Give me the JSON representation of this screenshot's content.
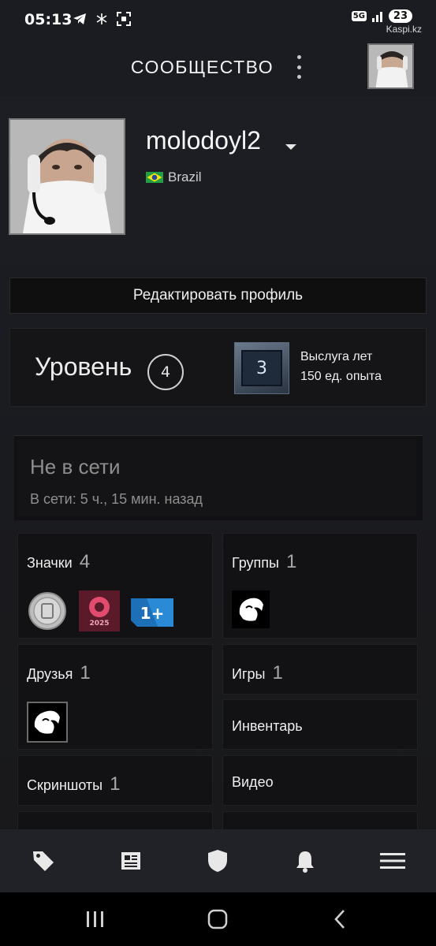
{
  "status_bar": {
    "time": "05:13",
    "network": "5G",
    "battery": "23",
    "watermark": "Kaspi.kz"
  },
  "header": {
    "title": "СООБЩЕСТВО",
    "menu_icon": "kebab-menu-icon",
    "avatar_icon": "user-avatar"
  },
  "profile": {
    "username": "molodoyl2",
    "country": "Brazil",
    "country_flag": "brazil-flag-icon",
    "edit_button": "Редактировать профиль"
  },
  "level": {
    "label": "Уровень",
    "value": "4",
    "badge_value": "3",
    "badge_title": "Выслуга лет",
    "badge_xp": "150 ед. опыта"
  },
  "status": {
    "title": "Не в сети",
    "last_online": "В сети: 5 ч., 15 мин. назад"
  },
  "tiles": {
    "badges": {
      "label": "Значки",
      "count": "4"
    },
    "groups": {
      "label": "Группы",
      "count": "1"
    },
    "friends": {
      "label": "Друзья",
      "count": "1"
    },
    "games": {
      "label": "Игры",
      "count": "1"
    },
    "inventory": {
      "label": "Инвентарь"
    },
    "screenshots": {
      "label": "Скриншоты",
      "count": "1"
    },
    "videos": {
      "label": "Видео"
    }
  },
  "badge_icons": [
    {
      "name": "coin-badge-icon"
    },
    {
      "name": "steam-2025-badge-icon",
      "label": "2025"
    },
    {
      "name": "years-of-service-badge-icon",
      "label": "1+"
    }
  ],
  "bottom_nav": [
    {
      "name": "store-tag-icon"
    },
    {
      "name": "news-icon"
    },
    {
      "name": "guard-shield-icon"
    },
    {
      "name": "notifications-bell-icon"
    },
    {
      "name": "hamburger-menu-icon"
    }
  ],
  "colors": {
    "background": "#1b1c20",
    "tile": "#121214",
    "text": "#efefef",
    "muted": "#8e8e8e"
  }
}
